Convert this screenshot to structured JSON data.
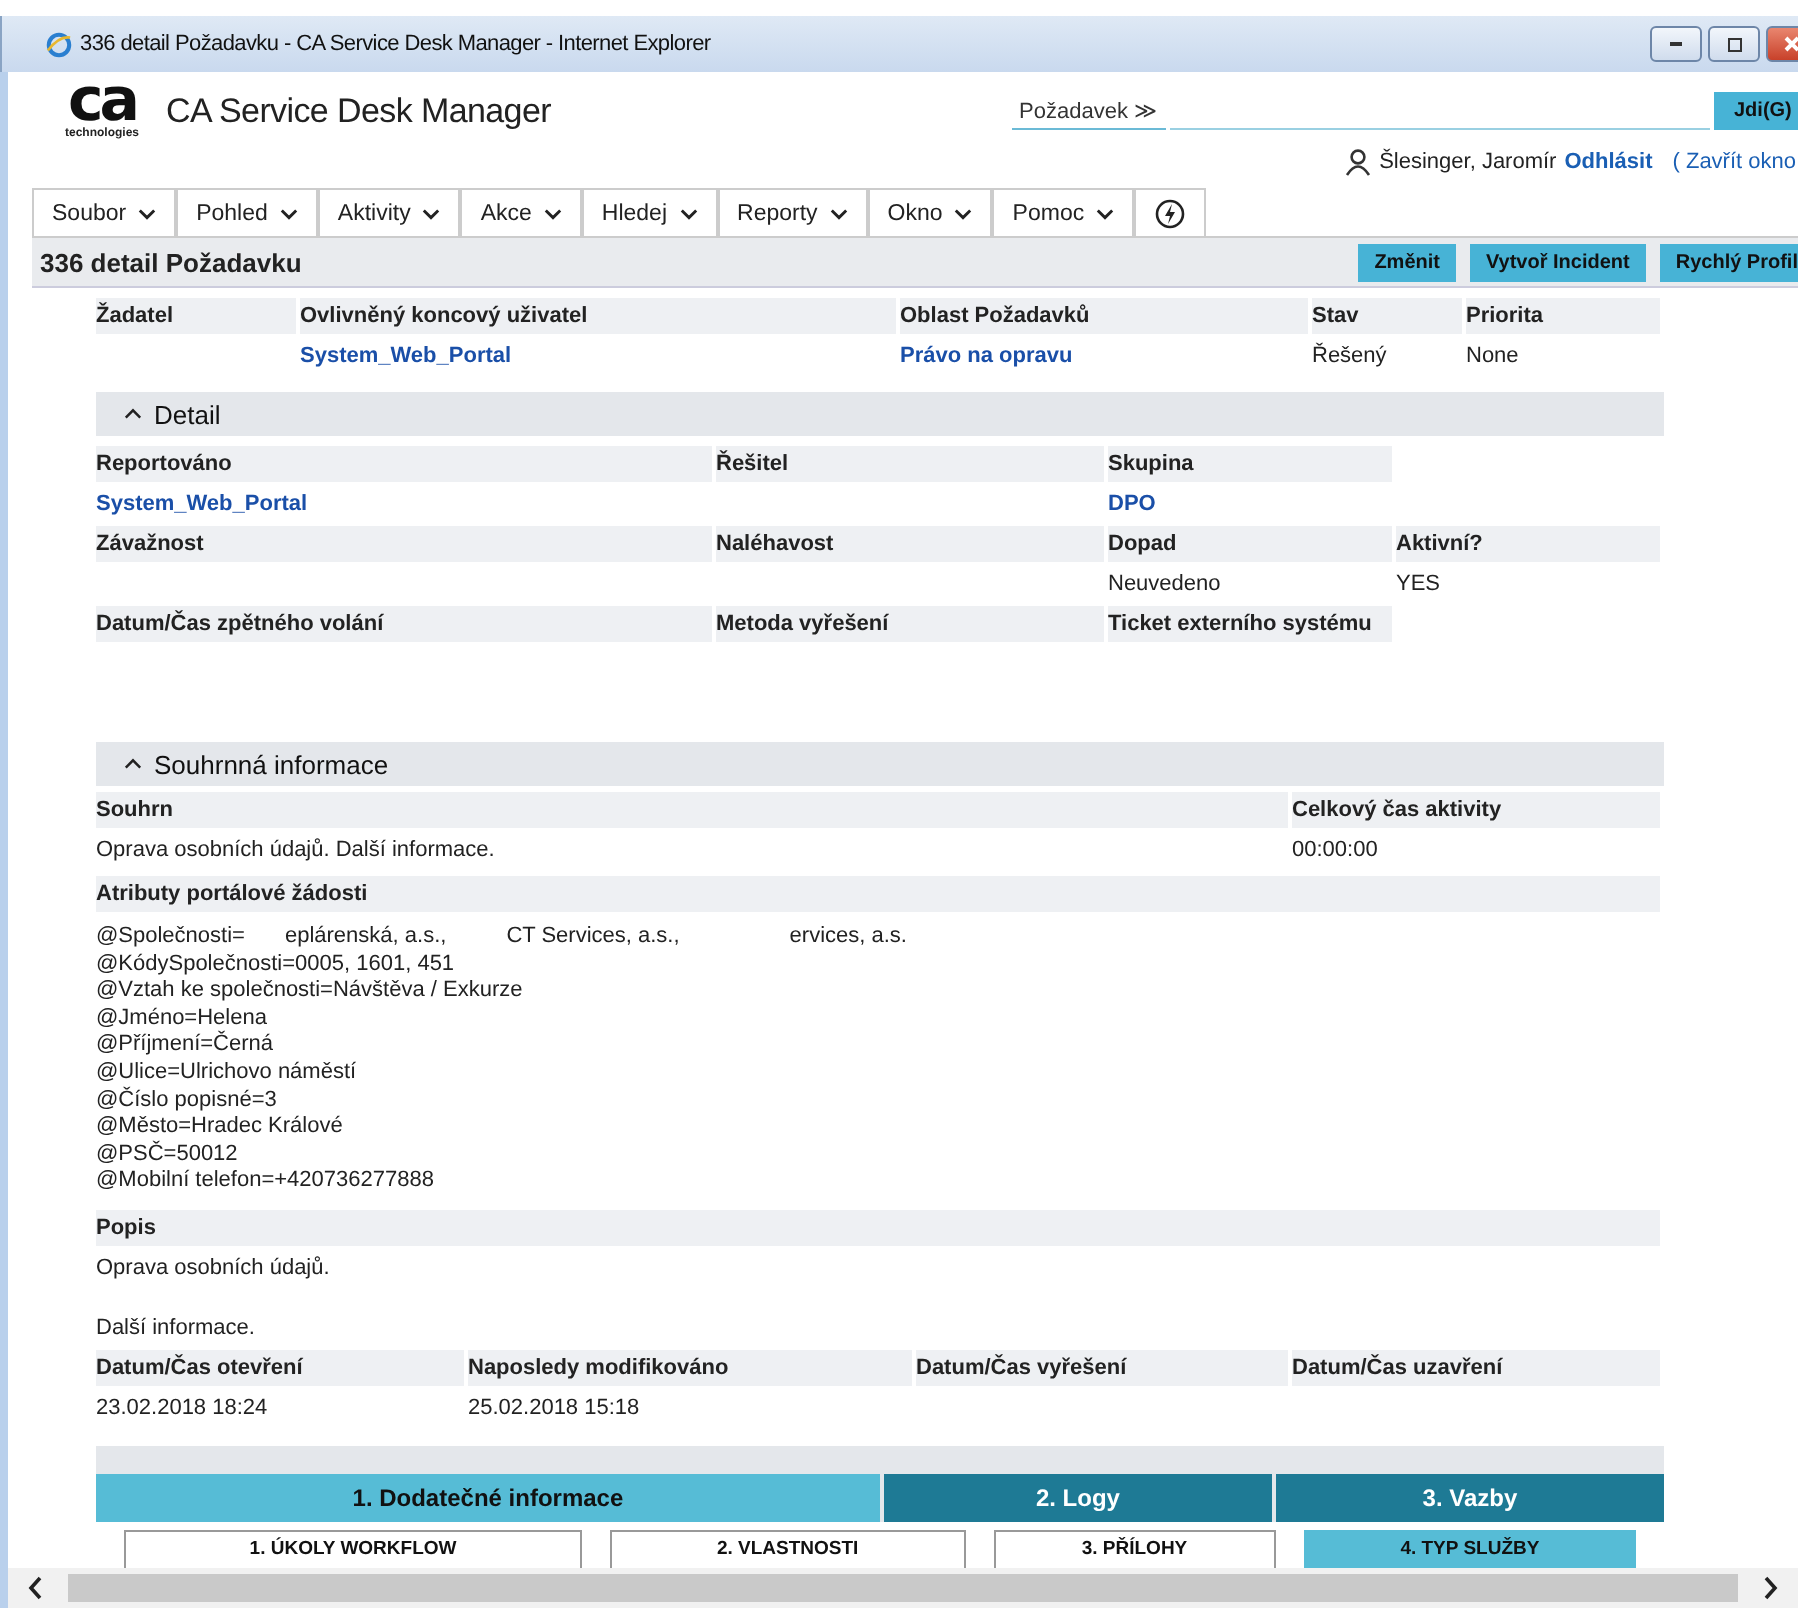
{
  "window": {
    "title": "336 detail Požadavku - CA Service Desk Manager - Internet Explorer"
  },
  "header": {
    "logo_mark": "ca",
    "logo_sub": "technologies",
    "product": "CA Service Desk Manager",
    "search_scope": "Požadavek ≫",
    "go_button": "Jdi(G)",
    "user": "Šlesinger, Jaromír",
    "logout": "Odhlásit",
    "close": "( Zavřít okno"
  },
  "menu": [
    {
      "label": "Soubor",
      "kind": "dropdown"
    },
    {
      "label": "Pohled",
      "kind": "dropdown"
    },
    {
      "label": "Aktivity",
      "kind": "dropdown"
    },
    {
      "label": "Akce",
      "kind": "dropdown"
    },
    {
      "label": "Hledej",
      "kind": "dropdown"
    },
    {
      "label": "Reporty",
      "kind": "dropdown"
    },
    {
      "label": "Okno",
      "kind": "dropdown"
    },
    {
      "label": "Pomoc",
      "kind": "dropdown"
    },
    {
      "kind": "icon"
    }
  ],
  "page": {
    "title": "336 detail Požadavku",
    "actions": [
      "Změnit",
      "Vytvoř Incident",
      "Rychlý Profil"
    ]
  },
  "top_fields": [
    {
      "label": "Žadatel"
    },
    {
      "label": "Ovlivněný koncový uživatel",
      "value": "System_Web_Portal",
      "link": true
    },
    {
      "label": "Oblast Požadavků",
      "value": "Právo na opravu",
      "link": true
    },
    {
      "label": "Stav",
      "value": "Řešený",
      "link": false
    },
    {
      "label": "Priorita",
      "value": "None",
      "link": false
    }
  ],
  "detail": {
    "title": "Detail",
    "expanded": true,
    "rows": [
      [
        {
          "label": "Reportováno",
          "value": "System_Web_Portal",
          "link": true
        },
        {
          "label": "Řešitel"
        },
        {
          "label": "Skupina",
          "value": "DPO",
          "link": true
        }
      ],
      [
        {
          "label": "Závažnost"
        },
        {
          "label": "Naléhavost"
        },
        {
          "label": "Dopad",
          "value": "Neuvedeno",
          "link": false
        },
        {
          "label": "Aktivní?",
          "value": "YES",
          "link": false
        }
      ],
      [
        {
          "label": "Datum/Čas zpětného volání"
        },
        {
          "label": "Metoda vyřešení"
        },
        {
          "label": "Ticket externího systému"
        }
      ]
    ]
  },
  "summary": {
    "title": "Souhrnná informace",
    "expanded": true,
    "summary_label": "Souhrn",
    "summary_value": "Oprava osobních údajů. Další informace.",
    "time_label": "Celkový čas aktivity",
    "time_value": "00:00:00",
    "attributes_label": "Atributy portálové žádosti",
    "attributes_first": [
      "@Společnosti=",
      "eplárenská, a.s.,",
      "CT Services, a.s.,",
      "ervices, a.s."
    ],
    "attributes": [
      "@KódySpolečnosti=0005, 1601, 451",
      "@Vztah ke společnosti=Návštěva / Exkurze",
      "@Jméno=Helena",
      "@Příjmení=Černá",
      "@Ulice=Ulrichovo náměstí",
      "@Číslo popisné=3",
      "@Město=Hradec Králové",
      "@PSČ=50012",
      "@Mobilní telefon=+420736277888"
    ],
    "description_label": "Popis",
    "description": [
      "Oprava osobních údajů.",
      "Další informace."
    ],
    "dates": [
      {
        "label": "Datum/Čas otevření",
        "value": "23.02.2018 18:24"
      },
      {
        "label": "Naposledy modifikováno",
        "value": "25.02.2018 15:18"
      },
      {
        "label": "Datum/Čas vyřešení"
      },
      {
        "label": "Datum/Čas uzavření"
      }
    ]
  },
  "tabs": [
    {
      "label": "1. Dodatečné informace",
      "selected": true
    },
    {
      "label": "2. Logy",
      "selected": false
    },
    {
      "label": "3. Vazby",
      "selected": false
    }
  ],
  "subtabs": [
    {
      "label": "1. ÚKOLY WORKFLOW",
      "selected": false
    },
    {
      "label": "2. VLASTNOSTI",
      "selected": false
    },
    {
      "label": "3. PŘÍLOHY",
      "selected": false
    },
    {
      "label": "4. TYP SLUŽBY",
      "selected": true
    }
  ]
}
